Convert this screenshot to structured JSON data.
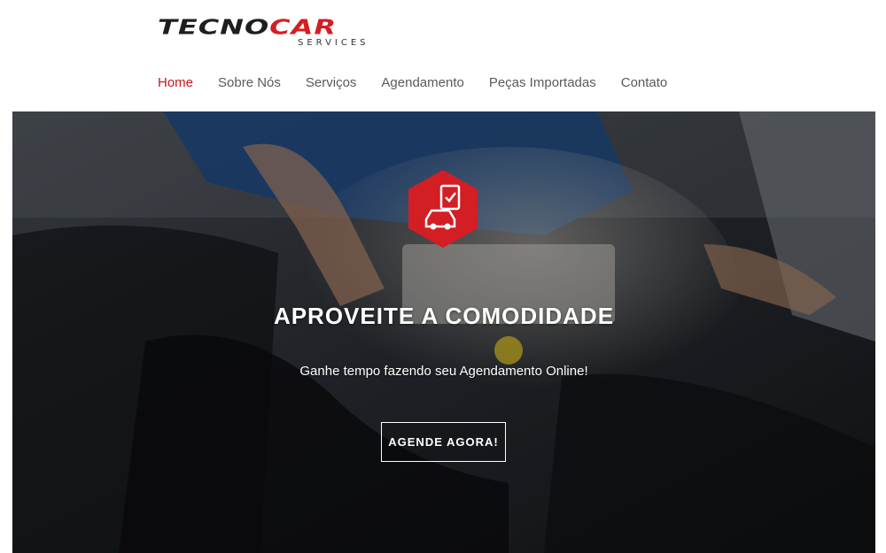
{
  "brand": {
    "logo_part1": "TECNO",
    "logo_part2": "CAR",
    "logo_sub": "SERVICES",
    "dark_color": "#1e1e1e",
    "accent_color": "#d31e24"
  },
  "nav": {
    "items": [
      {
        "label": "Home",
        "active": true
      },
      {
        "label": "Sobre Nós",
        "active": false
      },
      {
        "label": "Serviços",
        "active": false
      },
      {
        "label": "Agendamento",
        "active": false
      },
      {
        "label": "Peças Importadas",
        "active": false
      },
      {
        "label": "Contato",
        "active": false
      }
    ],
    "active_color": "#c8161d",
    "color": "#5a5a5a"
  },
  "hero": {
    "badge_icon": "car-checklist-icon",
    "title": "APROVEITE A COMODIDADE",
    "subtitle": "Ganhe tempo fazendo seu Agendamento Online!",
    "cta_label": "AGENDE AGORA!",
    "background_image": "mechanic-engine-photo"
  }
}
